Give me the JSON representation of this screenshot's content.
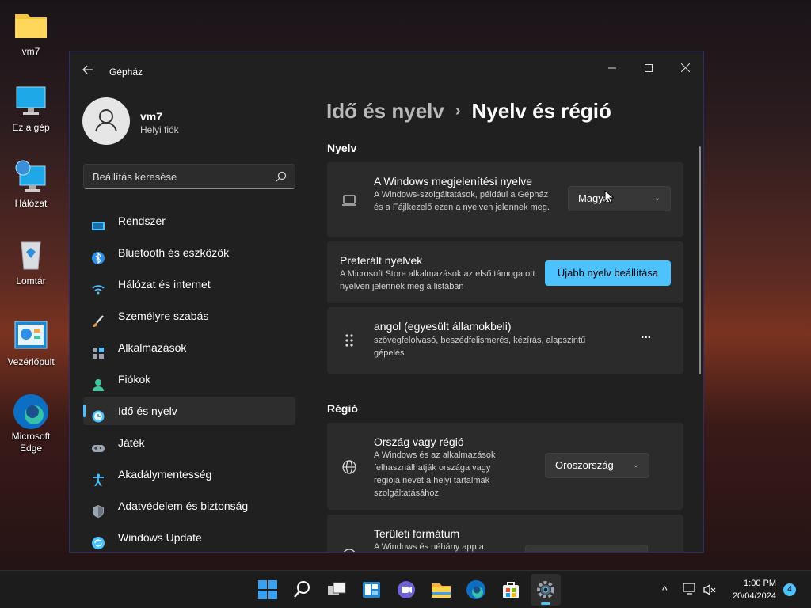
{
  "desktop": {
    "icons": [
      {
        "label": "vm7",
        "icon": "folder-icon"
      },
      {
        "label": "Ez a gép",
        "icon": "computer-icon"
      },
      {
        "label": "Hálózat",
        "icon": "network-icon"
      },
      {
        "label": "Lomtár",
        "icon": "recycle-bin-icon"
      },
      {
        "label": "Vezérlőpult",
        "icon": "control-panel-icon"
      },
      {
        "label": "Microsoft Edge",
        "icon": "edge-icon"
      }
    ]
  },
  "window": {
    "app_title": "Gépház",
    "profile": {
      "name": "vm7",
      "subtitle": "Helyi fiók"
    },
    "search": {
      "placeholder": "Beállítás keresése"
    },
    "nav": [
      {
        "label": "Rendszer",
        "icon": "system-icon",
        "color": "#4cc2ff"
      },
      {
        "label": "Bluetooth és eszközök",
        "icon": "bluetooth-icon",
        "color": "#2f8fe8"
      },
      {
        "label": "Hálózat és internet",
        "icon": "wifi-icon",
        "color": "#4cc2ff"
      },
      {
        "label": "Személyre szabás",
        "icon": "brush-icon",
        "color": "#e8a35a"
      },
      {
        "label": "Alkalmazások",
        "icon": "apps-icon",
        "color": "#9aa5b1"
      },
      {
        "label": "Fiókok",
        "icon": "account-icon",
        "color": "#3fc7a0"
      },
      {
        "label": "Idő és nyelv",
        "icon": "time-language-icon",
        "color": "#4cc2ff",
        "active": true
      },
      {
        "label": "Játék",
        "icon": "gaming-icon",
        "color": "#9aa5b1"
      },
      {
        "label": "Akadálymentesség",
        "icon": "accessibility-icon",
        "color": "#4cc2ff"
      },
      {
        "label": "Adatvédelem és biztonság",
        "icon": "shield-icon",
        "color": "#9aa5b1"
      },
      {
        "label": "Windows Update",
        "icon": "update-icon",
        "color": "#4cc2ff"
      }
    ],
    "breadcrumb": {
      "parent": "Idő és nyelv",
      "separator": "›",
      "current": "Nyelv és régió"
    },
    "language_section": {
      "heading": "Nyelv",
      "display_language": {
        "title": "A Windows megjelenítési nyelve",
        "desc": "A Windows-szolgáltatások, például a Gépház és a Fájlkezelő ezen a nyelven jelennek meg.",
        "value": "Magyar"
      },
      "preferred": {
        "title": "Preferált nyelvek",
        "desc": "A Microsoft Store alkalmazások az első támogatott nyelven jelennek meg a listában",
        "button": "Újabb nyelv beállítása"
      },
      "language_item": {
        "title": "angol (egyesült államokbeli)",
        "desc": "szövegfelolvasó, beszédfelismerés, kézírás, alapszintű gépelés",
        "more": "···"
      }
    },
    "region_section": {
      "heading": "Régió",
      "country": {
        "title": "Ország vagy régió",
        "desc": "A Windows és az alkalmazások felhasználhatják országa vagy régiója nevét a helyi tartalmak szolgáltatásához",
        "value": "Oroszország"
      },
      "format": {
        "title": "Területi formátum",
        "desc": "A Windows és néhány app a"
      }
    }
  },
  "taskbar": {
    "time": "1:00 PM",
    "date": "20/04/2024",
    "notifications": "4",
    "tray_chevron": "^"
  }
}
